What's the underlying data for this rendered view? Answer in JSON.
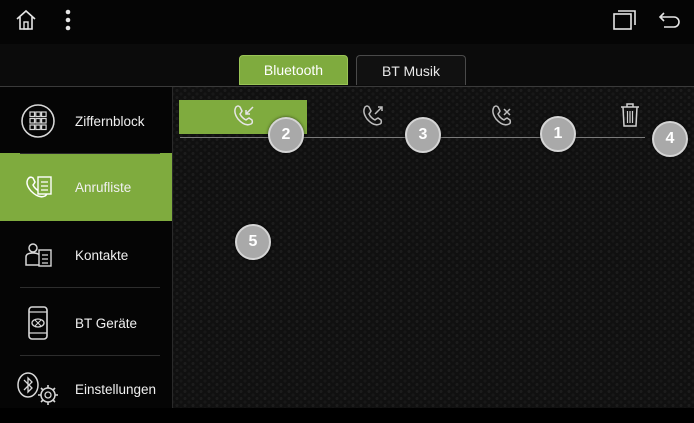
{
  "tabs": [
    {
      "label": "Bluetooth",
      "active": true
    },
    {
      "label": "BT Musik",
      "active": false
    }
  ],
  "sidebar": {
    "items": [
      {
        "label": "Ziffernblock",
        "icon": "keypad-icon",
        "active": false
      },
      {
        "label": "Anrufliste",
        "icon": "call-log-icon",
        "active": true
      },
      {
        "label": "Kontakte",
        "icon": "contacts-icon",
        "active": false
      },
      {
        "label": "BT Geräte",
        "icon": "bt-device-icon",
        "active": false
      },
      {
        "label": "Einstellungen",
        "icon": "bt-settings-icon",
        "active": false
      }
    ]
  },
  "toolbar": {
    "icons": [
      "incoming-call-icon",
      "outgoing-call-icon",
      "missed-call-icon",
      "trash-icon"
    ]
  },
  "badges": [
    "1",
    "2",
    "3",
    "4",
    "5"
  ],
  "colors": {
    "accent": "#7fab3e",
    "badge": "#a9a9a9"
  }
}
